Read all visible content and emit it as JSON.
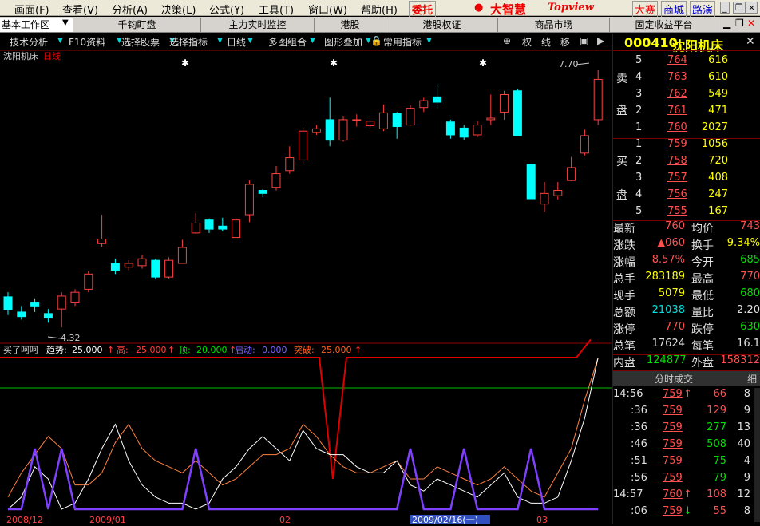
{
  "menu": [
    "画面(F)",
    "查看(V)",
    "分析(A)",
    "决策(L)",
    "公式(Y)",
    "工具(T)",
    "窗口(W)",
    "帮助(H)"
  ],
  "commission": "委托",
  "brand": "大智慧",
  "brand_sub": "Topview",
  "top_links": [
    "大赛",
    "商城",
    "路演"
  ],
  "tabs": [
    "基本工作区",
    "千钧盯盘",
    "主力实时监控",
    "港股",
    "港股权证",
    "商品市场",
    "固定收益平台"
  ],
  "tools": [
    "技术分析",
    "F10资料",
    "选择股票",
    "选择指标",
    "日线",
    "多图组合",
    "图形叠加",
    "常用指标"
  ],
  "tool_icons": [
    "权",
    "线",
    "移"
  ],
  "chart_title": "沈阳机床",
  "chart_period": "日线",
  "price_high_label": "7.70",
  "price_low_label": "4.32",
  "indicator": {
    "name": "买了呵呵",
    "trend_label": "趋势:",
    "trend": "25.000",
    "high_label": "高:",
    "high": "25.000",
    "top_label": "顶:",
    "top": "20.000",
    "start_label": "启动:",
    "start": "0.000",
    "break_label": "突破:",
    "break": "25.000"
  },
  "dates": [
    "2008/12",
    "2009/01",
    "02",
    "2009/02/16(一)",
    "03"
  ],
  "stock": {
    "code": "000410",
    "name": "沈阳机床"
  },
  "sell_label": [
    "卖",
    "盘"
  ],
  "buy_label": [
    "买",
    "盘"
  ],
  "sells": [
    {
      "n": "5",
      "p": "764",
      "v": "616"
    },
    {
      "n": "4",
      "p": "763",
      "v": "610"
    },
    {
      "n": "3",
      "p": "762",
      "v": "549"
    },
    {
      "n": "2",
      "p": "761",
      "v": "471"
    },
    {
      "n": "1",
      "p": "760",
      "v": "2027"
    }
  ],
  "buys": [
    {
      "n": "1",
      "p": "759",
      "v": "1056"
    },
    {
      "n": "2",
      "p": "758",
      "v": "720"
    },
    {
      "n": "3",
      "p": "757",
      "v": "408"
    },
    {
      "n": "4",
      "p": "756",
      "v": "247"
    },
    {
      "n": "5",
      "p": "755",
      "v": "167"
    }
  ],
  "quote": [
    {
      "l1": "最新",
      "v1": "760",
      "c1": "red",
      "l2": "均价",
      "v2": "743",
      "c2": "red"
    },
    {
      "l1": "涨跌",
      "v1": "▲060",
      "c1": "red",
      "l2": "换手",
      "v2": "9.34%",
      "c2": "yellow"
    },
    {
      "l1": "涨幅",
      "v1": "8.57%",
      "c1": "red",
      "l2": "今开",
      "v2": "685",
      "c2": "green"
    },
    {
      "l1": "总手",
      "v1": "283189",
      "c1": "yellow",
      "l2": "最高",
      "v2": "770",
      "c2": "red"
    },
    {
      "l1": "现手",
      "v1": "5079",
      "c1": "yellow",
      "l2": "最低",
      "v2": "680",
      "c2": "green"
    },
    {
      "l1": "总额",
      "v1": "21038",
      "c1": "cyan",
      "l2": "量比",
      "v2": "2.20",
      "c2": "white"
    },
    {
      "l1": "涨停",
      "v1": "770",
      "c1": "red",
      "l2": "跌停",
      "v2": "630",
      "c2": "green"
    },
    {
      "l1": "总笔",
      "v1": "17624",
      "c1": "white",
      "l2": "每笔",
      "v2": "16.1",
      "c2": "white"
    }
  ],
  "inner_label": "内盘",
  "inner": "124877",
  "outer_label": "外盘",
  "outer": "158312",
  "ticks_title": "分时成交",
  "ticks_tab": "细",
  "ticks": [
    {
      "t": "14:56",
      "p": "759",
      "arrow": "↑",
      "v": "66",
      "n": "8",
      "vc": "red"
    },
    {
      "t": ":36",
      "p": "759",
      "arrow": "",
      "v": "129",
      "n": "9",
      "vc": "red"
    },
    {
      "t": ":36",
      "p": "759",
      "arrow": "",
      "v": "277",
      "n": "13",
      "vc": "green"
    },
    {
      "t": ":46",
      "p": "759",
      "arrow": "",
      "v": "508",
      "n": "40",
      "vc": "green"
    },
    {
      "t": ":51",
      "p": "759",
      "arrow": "",
      "v": "75",
      "n": "4",
      "vc": "green"
    },
    {
      "t": ":56",
      "p": "759",
      "arrow": "",
      "v": "79",
      "n": "9",
      "vc": "green"
    },
    {
      "t": "14:57",
      "p": "760",
      "arrow": "↑",
      "v": "108",
      "n": "12",
      "vc": "red"
    },
    {
      "t": ":06",
      "p": "759",
      "arrow": "↓",
      "v": "55",
      "n": "8",
      "vc": "red"
    }
  ],
  "chart_data": {
    "type": "candlestick",
    "ylim": [
      4.32,
      7.7
    ],
    "candles": [
      [
        4.72,
        4.55,
        4.78,
        4.48
      ],
      [
        4.52,
        4.46,
        4.6,
        4.42
      ],
      [
        4.65,
        4.6,
        4.7,
        4.52
      ],
      [
        4.5,
        4.44,
        4.56,
        4.38
      ],
      [
        4.56,
        4.73,
        4.78,
        4.32
      ],
      [
        4.65,
        4.78,
        4.82,
        4.6
      ],
      [
        4.82,
        5.02,
        5.06,
        4.78
      ],
      [
        5.42,
        5.48,
        5.8,
        5.38
      ],
      [
        5.16,
        5.07,
        5.22,
        5.02
      ],
      [
        5.11,
        5.16,
        5.2,
        5.07
      ],
      [
        5.13,
        5.22,
        5.27,
        5.09
      ],
      [
        5.2,
        4.98,
        5.22,
        4.95
      ],
      [
        4.98,
        5.2,
        5.24,
        4.96
      ],
      [
        5.16,
        5.37,
        5.47,
        5.16
      ],
      [
        5.56,
        5.69,
        5.82,
        5.55
      ],
      [
        5.73,
        5.61,
        5.75,
        5.56
      ],
      [
        5.65,
        5.61,
        5.76,
        5.58
      ],
      [
        5.5,
        5.73,
        5.75,
        5.5
      ],
      [
        5.8,
        6.2,
        6.25,
        5.7
      ],
      [
        6.12,
        6.08,
        6.14,
        6.03
      ],
      [
        6.16,
        6.34,
        6.44,
        6.12
      ],
      [
        6.38,
        6.55,
        6.7,
        6.34
      ],
      [
        6.52,
        6.9,
        6.95,
        6.45
      ],
      [
        6.88,
        6.93,
        6.98,
        6.85
      ],
      [
        7.05,
        6.78,
        7.34,
        6.7
      ],
      [
        6.78,
        7.05,
        7.1,
        6.76
      ],
      [
        7.05,
        7.05,
        7.12,
        6.96
      ],
      [
        6.97,
        7.03,
        7.05,
        6.94
      ],
      [
        6.93,
        7.14,
        7.25,
        6.9
      ],
      [
        7.13,
        6.96,
        7.15,
        6.8
      ],
      [
        6.98,
        7.2,
        7.24,
        6.97
      ],
      [
        7.21,
        7.3,
        7.34,
        7.15
      ],
      [
        7.35,
        7.28,
        7.52,
        7.2
      ],
      [
        7.02,
        6.85,
        7.05,
        6.8
      ],
      [
        6.94,
        6.82,
        6.98,
        6.78
      ],
      [
        6.85,
        6.98,
        7.03,
        6.82
      ],
      [
        7.05,
        7.07,
        7.38,
        6.98
      ],
      [
        7.15,
        7.38,
        7.43,
        7.05
      ],
      [
        7.43,
        6.84,
        7.45,
        6.84
      ],
      [
        6.46,
        6.01,
        6.46,
        6.01
      ],
      [
        5.94,
        6.08,
        6.23,
        5.84
      ],
      [
        6.05,
        6.12,
        6.23,
        6.0
      ],
      [
        6.25,
        6.42,
        6.56,
        6.24
      ],
      [
        6.61,
        6.84,
        6.92,
        6.58
      ],
      [
        7.05,
        7.58,
        7.7,
        6.98
      ]
    ]
  }
}
